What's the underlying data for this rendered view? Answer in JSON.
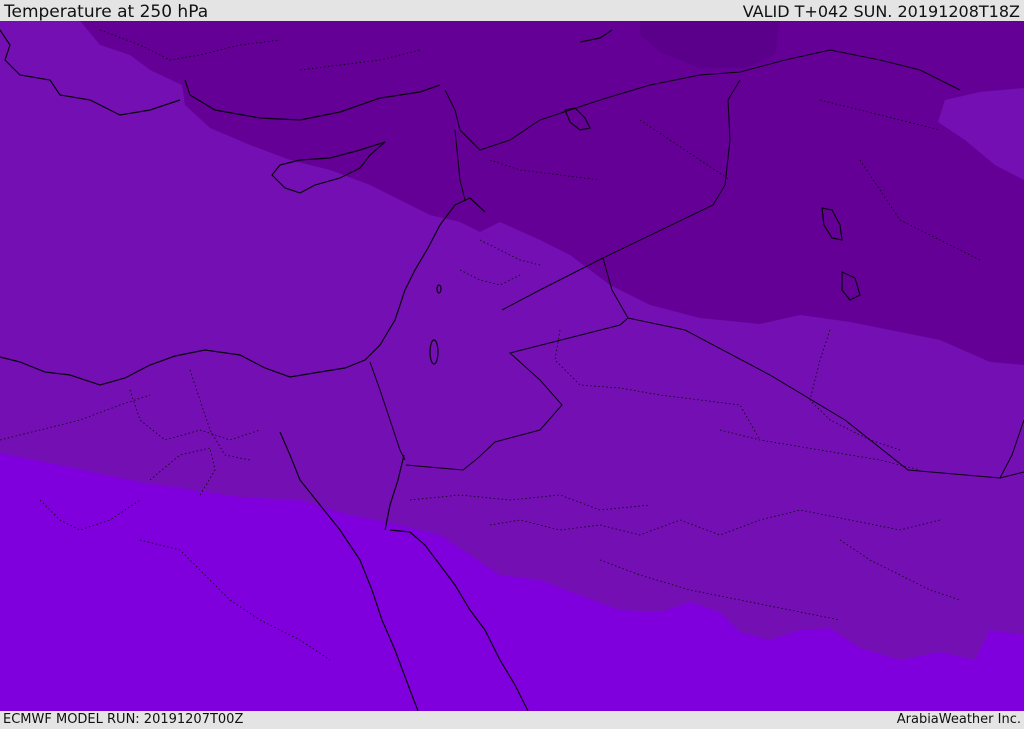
{
  "header": {
    "title": "Temperature at 250 hPa",
    "valid_time": "VALID T+042 SUN. 20191208T18Z"
  },
  "footer": {
    "model_run": "ECMWF MODEL RUN: 20191207T00Z",
    "credit": "ArabiaWeather Inc."
  },
  "map": {
    "colors": {
      "band_coldest": "#5a008a",
      "band_cold": "#650097",
      "band_mid": "#7410b3",
      "band_warm": "#7f00dd",
      "coastline": "#0a0010"
    }
  }
}
